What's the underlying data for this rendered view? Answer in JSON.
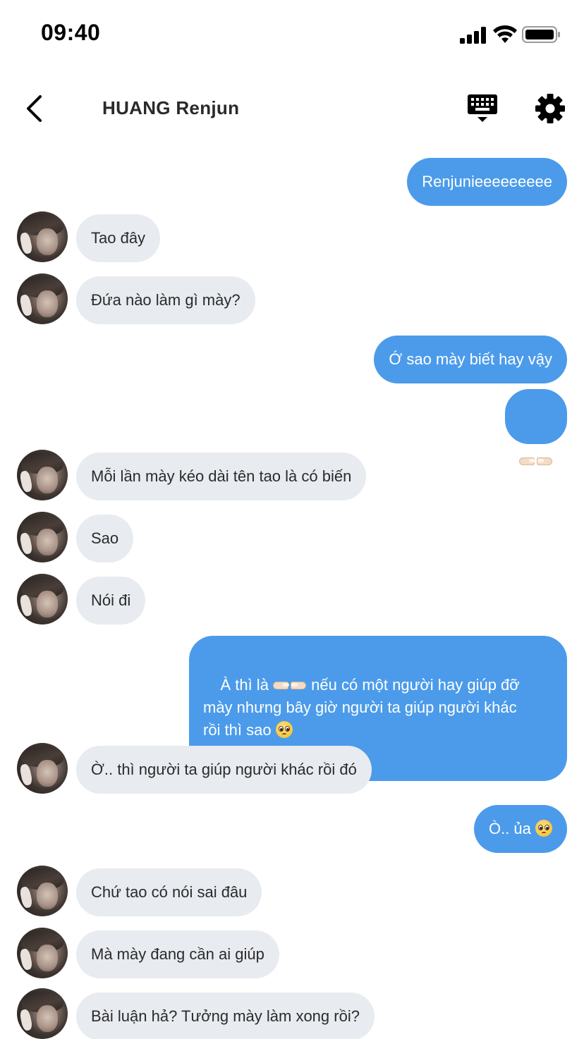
{
  "status_bar": {
    "time": "09:40",
    "icons": [
      "cellular-signal-icon",
      "wifi-icon",
      "battery-icon"
    ]
  },
  "header": {
    "back_icon": "chevron-left-icon",
    "title": "HUANG Renjun",
    "keyboard_icon": "keyboard-icon",
    "settings_icon": "gear-icon"
  },
  "colors": {
    "outgoing_bubble": "#4b9bea",
    "incoming_bubble": "#e8ebf0",
    "outgoing_text": "#ffffff",
    "incoming_text": "#2b2b2b"
  },
  "messages": [
    {
      "sender": "me",
      "text": "Renjunieeeeeeeee"
    },
    {
      "sender": "them",
      "text": "Tao đây"
    },
    {
      "sender": "them",
      "text": "Đứa nào làm gì mày?"
    },
    {
      "sender": "me",
      "text": "Ớ sao mày biết hay vậy"
    },
    {
      "sender": "me",
      "emoji": "pointing-fingers-emoji"
    },
    {
      "sender": "them",
      "text": "Mỗi lần mày kéo dài tên tao là có biến"
    },
    {
      "sender": "them",
      "text": "Sao"
    },
    {
      "sender": "them",
      "text": "Nói đi"
    },
    {
      "sender": "me",
      "text_before_emoji": "À thì là ",
      "emoji": "pointing-fingers-emoji",
      "text_line1_rest": "nếu có một người hay giúp đỡ",
      "text_line2": "mày nhưng bây giờ người ta giúp người khác",
      "text_line3": "rồi thì sao ",
      "end_emoji": "pleading-face-emoji"
    },
    {
      "sender": "them",
      "text": "Ờ.. thì người ta giúp người khác rồi đó"
    },
    {
      "sender": "me",
      "text": "Ò.. ủa ",
      "end_emoji": "pleading-face-emoji"
    },
    {
      "sender": "them",
      "text": "Chứ tao có nói sai đâu"
    },
    {
      "sender": "them",
      "text": "Mà mày đang cần ai giúp"
    },
    {
      "sender": "them",
      "text": "Bài luận hả? Tưởng mày làm xong rồi?"
    }
  ]
}
